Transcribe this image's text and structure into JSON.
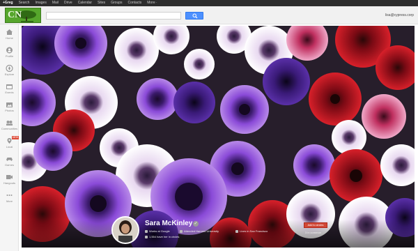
{
  "gbar": {
    "items": [
      "+Greg",
      "Search",
      "Images",
      "Mail",
      "Drive",
      "Calendar",
      "Sites",
      "Groups",
      "Contacts",
      "More ·"
    ]
  },
  "header": {
    "logo_text": "CN",
    "search_placeholder": "",
    "search_value": "",
    "user_email": "lisa@cypress.corp"
  },
  "leftnav": {
    "items": [
      {
        "label": "Home",
        "icon": "home-icon"
      },
      {
        "label": "Profile",
        "icon": "profile-icon"
      },
      {
        "label": "Explore",
        "icon": "explore-icon"
      },
      {
        "label": "Events",
        "icon": "events-icon"
      },
      {
        "label": "Photos",
        "icon": "photos-icon"
      },
      {
        "label": "Communities",
        "icon": "communities-icon"
      },
      {
        "label": "Local",
        "icon": "local-icon"
      },
      {
        "label": "Games",
        "icon": "games-icon"
      },
      {
        "label": "Hangouts",
        "icon": "hangouts-icon"
      },
      {
        "label": "More",
        "icon": "more-icon"
      }
    ],
    "badge": "NEW"
  },
  "profile": {
    "name": "Sara McKinley",
    "works_at": "Works at Google",
    "attended": "Attended Harvard University",
    "lives_in": "Lives in San Francisco",
    "followers": "1,554 have her in circles",
    "add_button": "Add to circles",
    "circle_count": "3 in common"
  },
  "colors": {
    "gbar": "#2d2d2d",
    "search_button": "#4d90fe",
    "logo": "#56a62c",
    "add_button": "#d14836"
  }
}
